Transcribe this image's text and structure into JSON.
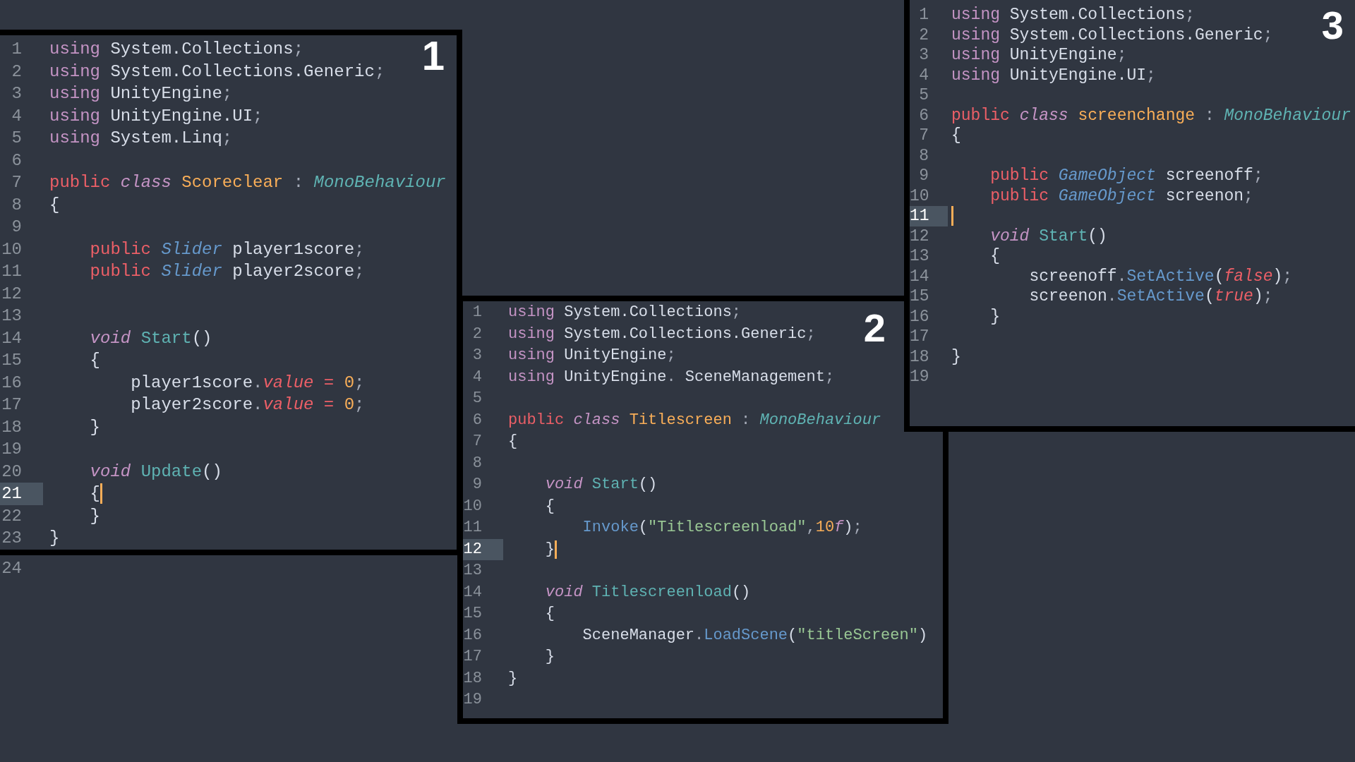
{
  "panels": [
    {
      "label": "1",
      "lines": [
        {
          "number": "1",
          "current": false,
          "tokens": [
            {
              "kind": "keyword",
              "text": "using"
            },
            {
              "kind": "plain",
              "text": " System.Collections"
            },
            {
              "kind": "punct",
              "text": ";"
            }
          ]
        },
        {
          "number": "2",
          "current": false,
          "tokens": [
            {
              "kind": "keyword",
              "text": "using"
            },
            {
              "kind": "plain",
              "text": " System.Collections.Generic"
            },
            {
              "kind": "punct",
              "text": ";"
            }
          ]
        },
        {
          "number": "3",
          "current": false,
          "tokens": [
            {
              "kind": "keyword",
              "text": "using"
            },
            {
              "kind": "plain",
              "text": " UnityEngine"
            },
            {
              "kind": "punct",
              "text": ";"
            }
          ]
        },
        {
          "number": "4",
          "current": false,
          "tokens": [
            {
              "kind": "keyword",
              "text": "using"
            },
            {
              "kind": "plain",
              "text": " UnityEngine.UI"
            },
            {
              "kind": "punct",
              "text": ";"
            }
          ]
        },
        {
          "number": "5",
          "current": false,
          "tokens": [
            {
              "kind": "keyword",
              "text": "using"
            },
            {
              "kind": "plain",
              "text": " System.Linq"
            },
            {
              "kind": "punct",
              "text": ";"
            }
          ]
        },
        {
          "number": "6",
          "current": false
        },
        {
          "number": "7",
          "current": false,
          "tokens": [
            {
              "kind": "modifier",
              "text": "public "
            },
            {
              "kind": "storage",
              "text": "class "
            },
            {
              "kind": "classname",
              "text": "Scoreclear"
            },
            {
              "kind": "punct",
              "text": " : "
            },
            {
              "kind": "inherited",
              "text": "MonoBehaviour"
            }
          ]
        },
        {
          "number": "8",
          "current": false,
          "tokens": [
            {
              "kind": "plain",
              "text": "{"
            }
          ]
        },
        {
          "number": "9",
          "current": false
        },
        {
          "number": "10",
          "current": false,
          "tokens": [
            {
              "kind": "modifier",
              "text": "    public "
            },
            {
              "kind": "type",
              "text": "Slider"
            },
            {
              "kind": "plain",
              "text": " player1score"
            },
            {
              "kind": "punct",
              "text": ";"
            }
          ]
        },
        {
          "number": "11",
          "current": false,
          "tokens": [
            {
              "kind": "modifier",
              "text": "    public "
            },
            {
              "kind": "type",
              "text": "Slider"
            },
            {
              "kind": "plain",
              "text": " player2score"
            },
            {
              "kind": "punct",
              "text": ";"
            }
          ]
        },
        {
          "number": "12",
          "current": false
        },
        {
          "number": "13",
          "current": false
        },
        {
          "number": "14",
          "current": false,
          "tokens": [
            {
              "kind": "storage",
              "text": "    void "
            },
            {
              "kind": "function",
              "text": "Start"
            },
            {
              "kind": "plain",
              "text": "()"
            }
          ]
        },
        {
          "number": "15",
          "current": false,
          "tokens": [
            {
              "kind": "plain",
              "text": "    {"
            }
          ]
        },
        {
          "number": "16",
          "current": false,
          "tokens": [
            {
              "kind": "plain",
              "text": "        player1score"
            },
            {
              "kind": "punct",
              "text": "."
            },
            {
              "kind": "property",
              "text": "value"
            },
            {
              "kind": "operator",
              "text": " = "
            },
            {
              "kind": "number",
              "text": "0"
            },
            {
              "kind": "punct",
              "text": ";"
            }
          ]
        },
        {
          "number": "17",
          "current": false,
          "tokens": [
            {
              "kind": "plain",
              "text": "        player2score"
            },
            {
              "kind": "punct",
              "text": "."
            },
            {
              "kind": "property",
              "text": "value"
            },
            {
              "kind": "operator",
              "text": " = "
            },
            {
              "kind": "number",
              "text": "0"
            },
            {
              "kind": "punct",
              "text": ";"
            }
          ]
        },
        {
          "number": "18",
          "current": false,
          "tokens": [
            {
              "kind": "plain",
              "text": "    }"
            }
          ]
        },
        {
          "number": "19",
          "current": false
        },
        {
          "number": "20",
          "current": false,
          "tokens": [
            {
              "kind": "storage",
              "text": "    void "
            },
            {
              "kind": "function",
              "text": "Update"
            },
            {
              "kind": "plain",
              "text": "()"
            }
          ]
        },
        {
          "number": "21",
          "current": true,
          "tokens": [
            {
              "kind": "plain",
              "text": "    {"
            }
          ]
        },
        {
          "number": "22",
          "current": false,
          "tokens": [
            {
              "kind": "plain",
              "text": "    }"
            }
          ]
        },
        {
          "number": "23",
          "current": false,
          "tokens": [
            {
              "kind": "plain",
              "text": "}"
            }
          ]
        }
      ]
    },
    {
      "label": "2",
      "lines": [
        {
          "number": "1",
          "current": false,
          "tokens": [
            {
              "kind": "keyword",
              "text": "using"
            },
            {
              "kind": "plain",
              "text": " System.Collections"
            },
            {
              "kind": "punct",
              "text": ";"
            }
          ]
        },
        {
          "number": "2",
          "current": false,
          "tokens": [
            {
              "kind": "keyword",
              "text": "using"
            },
            {
              "kind": "plain",
              "text": " System.Collections.Generic"
            },
            {
              "kind": "punct",
              "text": ";"
            }
          ]
        },
        {
          "number": "3",
          "current": false,
          "tokens": [
            {
              "kind": "keyword",
              "text": "using"
            },
            {
              "kind": "plain",
              "text": " UnityEngine"
            },
            {
              "kind": "punct",
              "text": ";"
            }
          ]
        },
        {
          "number": "4",
          "current": false,
          "tokens": [
            {
              "kind": "keyword",
              "text": "using"
            },
            {
              "kind": "plain",
              "text": " UnityEngine"
            },
            {
              "kind": "punct",
              "text": ". "
            },
            {
              "kind": "plain",
              "text": "SceneManagement"
            },
            {
              "kind": "punct",
              "text": ";"
            }
          ]
        },
        {
          "number": "5",
          "current": false
        },
        {
          "number": "6",
          "current": false,
          "tokens": [
            {
              "kind": "modifier",
              "text": "public "
            },
            {
              "kind": "storage",
              "text": "class "
            },
            {
              "kind": "classname",
              "text": "Titlescreen"
            },
            {
              "kind": "punct",
              "text": " : "
            },
            {
              "kind": "inherited",
              "text": "MonoBehaviour"
            }
          ]
        },
        {
          "number": "7",
          "current": false,
          "tokens": [
            {
              "kind": "plain",
              "text": "{"
            }
          ]
        },
        {
          "number": "8",
          "current": false
        },
        {
          "number": "9",
          "current": false,
          "tokens": [
            {
              "kind": "storage",
              "text": "    void "
            },
            {
              "kind": "function",
              "text": "Start"
            },
            {
              "kind": "plain",
              "text": "()"
            }
          ]
        },
        {
          "number": "10",
          "current": false,
          "tokens": [
            {
              "kind": "plain",
              "text": "    {"
            }
          ]
        },
        {
          "number": "11",
          "current": false,
          "tokens": [
            {
              "kind": "call",
              "text": "        Invoke"
            },
            {
              "kind": "plain",
              "text": "("
            },
            {
              "kind": "string",
              "text": "\"Titlescreenload\""
            },
            {
              "kind": "punct",
              "text": ","
            },
            {
              "kind": "number",
              "text": "10"
            },
            {
              "kind": "suffix",
              "text": "f"
            },
            {
              "kind": "plain",
              "text": ")"
            },
            {
              "kind": "punct",
              "text": ";"
            }
          ]
        },
        {
          "number": "12",
          "current": true,
          "tokens": [
            {
              "kind": "plain",
              "text": "    }"
            }
          ]
        },
        {
          "number": "13",
          "current": false
        },
        {
          "number": "14",
          "current": false,
          "tokens": [
            {
              "kind": "storage",
              "text": "    void "
            },
            {
              "kind": "function",
              "text": "Titlescreenload"
            },
            {
              "kind": "plain",
              "text": "()"
            }
          ]
        },
        {
          "number": "15",
          "current": false,
          "tokens": [
            {
              "kind": "plain",
              "text": "    {"
            }
          ]
        },
        {
          "number": "16",
          "current": false,
          "tokens": [
            {
              "kind": "plain",
              "text": "        SceneManager"
            },
            {
              "kind": "punct",
              "text": "."
            },
            {
              "kind": "call",
              "text": "LoadScene"
            },
            {
              "kind": "plain",
              "text": "("
            },
            {
              "kind": "string",
              "text": "\"titleScreen\""
            },
            {
              "kind": "plain",
              "text": ")"
            }
          ]
        },
        {
          "number": "17",
          "current": false,
          "tokens": [
            {
              "kind": "plain",
              "text": "    }"
            }
          ]
        },
        {
          "number": "18",
          "current": false,
          "tokens": [
            {
              "kind": "plain",
              "text": "}"
            }
          ]
        },
        {
          "number": "19",
          "current": false
        }
      ]
    },
    {
      "label": "3",
      "lines": [
        {
          "number": "1",
          "current": false,
          "tokens": [
            {
              "kind": "keyword",
              "text": "using"
            },
            {
              "kind": "plain",
              "text": " System.Collections"
            },
            {
              "kind": "punct",
              "text": ";"
            }
          ]
        },
        {
          "number": "2",
          "current": false,
          "tokens": [
            {
              "kind": "keyword",
              "text": "using"
            },
            {
              "kind": "plain",
              "text": " System.Collections.Generic"
            },
            {
              "kind": "punct",
              "text": ";"
            }
          ]
        },
        {
          "number": "3",
          "current": false,
          "tokens": [
            {
              "kind": "keyword",
              "text": "using"
            },
            {
              "kind": "plain",
              "text": " UnityEngine"
            },
            {
              "kind": "punct",
              "text": ";"
            }
          ]
        },
        {
          "number": "4",
          "current": false,
          "tokens": [
            {
              "kind": "keyword",
              "text": "using"
            },
            {
              "kind": "plain",
              "text": " UnityEngine.UI"
            },
            {
              "kind": "punct",
              "text": ";"
            }
          ]
        },
        {
          "number": "5",
          "current": false
        },
        {
          "number": "6",
          "current": false,
          "tokens": [
            {
              "kind": "modifier",
              "text": "public "
            },
            {
              "kind": "storage",
              "text": "class "
            },
            {
              "kind": "classname",
              "text": "screenchange"
            },
            {
              "kind": "punct",
              "text": " : "
            },
            {
              "kind": "inherited",
              "text": "MonoBehaviour"
            }
          ]
        },
        {
          "number": "7",
          "current": false,
          "tokens": [
            {
              "kind": "plain",
              "text": "{"
            }
          ]
        },
        {
          "number": "8",
          "current": false
        },
        {
          "number": "9",
          "current": false,
          "tokens": [
            {
              "kind": "modifier",
              "text": "    public "
            },
            {
              "kind": "type",
              "text": "GameObject"
            },
            {
              "kind": "plain",
              "text": " screenoff"
            },
            {
              "kind": "punct",
              "text": ";"
            }
          ]
        },
        {
          "number": "10",
          "current": false,
          "tokens": [
            {
              "kind": "modifier",
              "text": "    public "
            },
            {
              "kind": "type",
              "text": "GameObject"
            },
            {
              "kind": "plain",
              "text": " screenon"
            },
            {
              "kind": "punct",
              "text": ";"
            }
          ]
        },
        {
          "number": "11",
          "current": true
        },
        {
          "number": "12",
          "current": false,
          "tokens": [
            {
              "kind": "storage",
              "text": "    void "
            },
            {
              "kind": "function",
              "text": "Start"
            },
            {
              "kind": "plain",
              "text": "()"
            }
          ]
        },
        {
          "number": "13",
          "current": false,
          "tokens": [
            {
              "kind": "plain",
              "text": "    {"
            }
          ]
        },
        {
          "number": "14",
          "current": false,
          "tokens": [
            {
              "kind": "plain",
              "text": "        screenoff"
            },
            {
              "kind": "punct",
              "text": "."
            },
            {
              "kind": "call",
              "text": "SetActive"
            },
            {
              "kind": "plain",
              "text": "("
            },
            {
              "kind": "property",
              "text": "false"
            },
            {
              "kind": "plain",
              "text": ")"
            },
            {
              "kind": "punct",
              "text": ";"
            }
          ]
        },
        {
          "number": "15",
          "current": false,
          "tokens": [
            {
              "kind": "plain",
              "text": "        screenon"
            },
            {
              "kind": "punct",
              "text": "."
            },
            {
              "kind": "call",
              "text": "SetActive"
            },
            {
              "kind": "plain",
              "text": "("
            },
            {
              "kind": "property",
              "text": "true"
            },
            {
              "kind": "plain",
              "text": ")"
            },
            {
              "kind": "punct",
              "text": ";"
            }
          ]
        },
        {
          "number": "16",
          "current": false,
          "tokens": [
            {
              "kind": "plain",
              "text": "    }"
            }
          ]
        },
        {
          "number": "17",
          "current": false
        },
        {
          "number": "18",
          "current": false,
          "tokens": [
            {
              "kind": "plain",
              "text": "}"
            }
          ]
        },
        {
          "number": "19",
          "current": false
        }
      ]
    }
  ],
  "background_editor": {
    "line_numbers": [
      "24"
    ]
  }
}
